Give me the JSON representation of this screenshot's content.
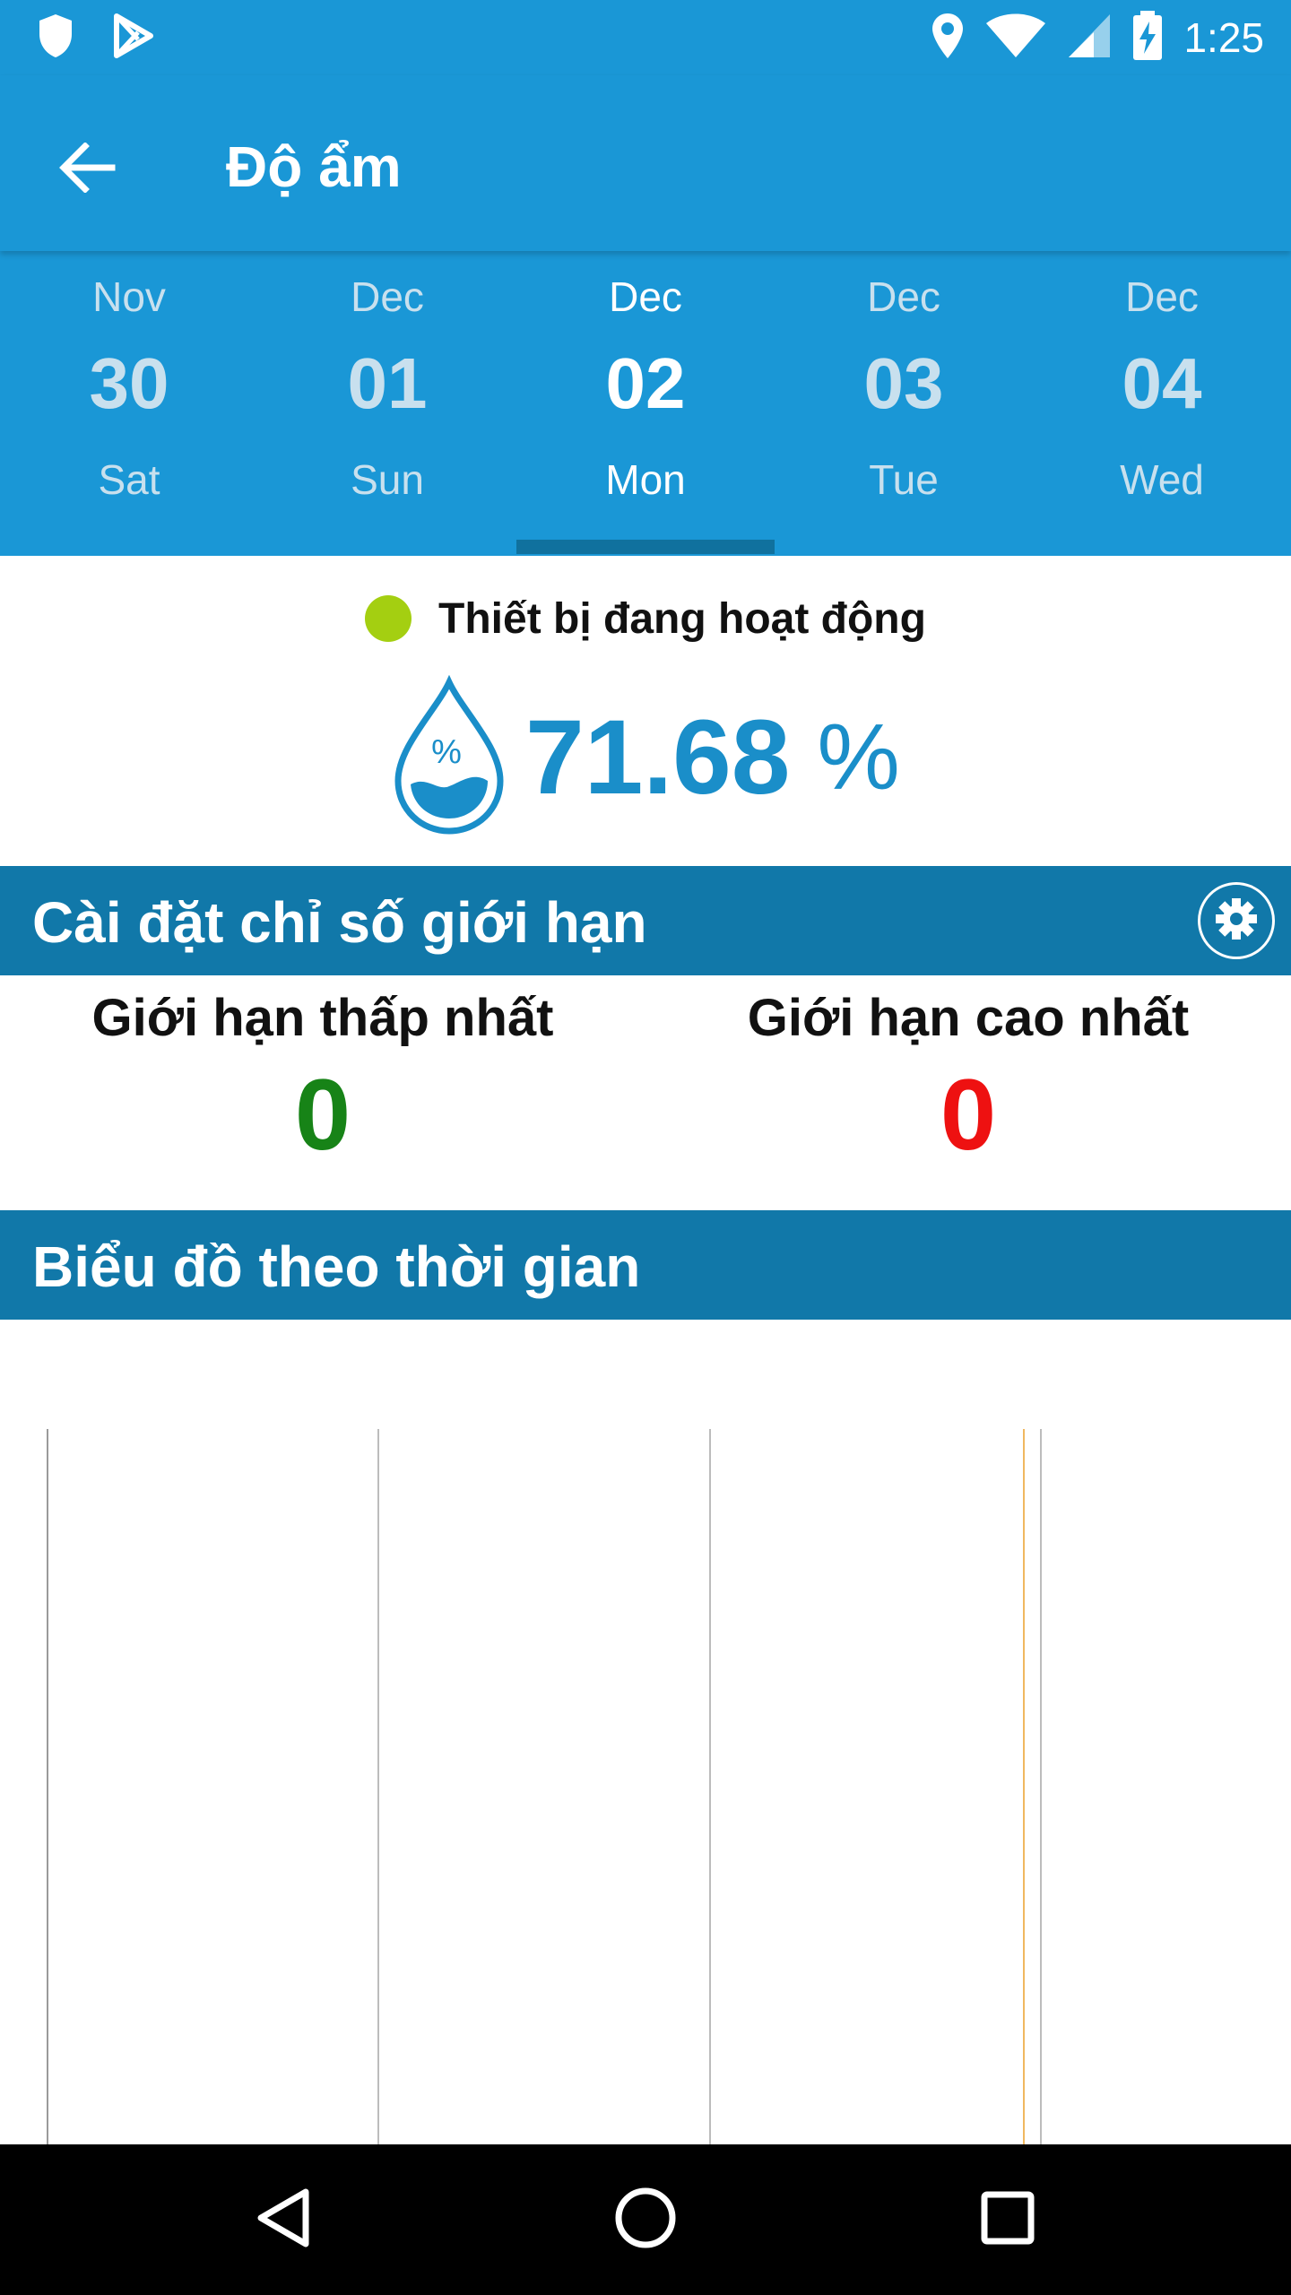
{
  "status_bar": {
    "time": "1:25",
    "left_icons": [
      "shield-icon",
      "play-store-icon"
    ],
    "right_icons": [
      "location-icon",
      "wifi-icon",
      "cell-signal-icon",
      "battery-charging-icon"
    ]
  },
  "app_bar": {
    "title": "Độ ẩm",
    "back_icon": "arrow-left-icon"
  },
  "dates": [
    {
      "month": "Nov",
      "day": "30",
      "weekday": "Sat",
      "selected": false
    },
    {
      "month": "Dec",
      "day": "01",
      "weekday": "Sun",
      "selected": false
    },
    {
      "month": "Dec",
      "day": "02",
      "weekday": "Mon",
      "selected": true
    },
    {
      "month": "Dec",
      "day": "03",
      "weekday": "Tue",
      "selected": false
    },
    {
      "month": "Dec",
      "day": "04",
      "weekday": "Wed",
      "selected": false
    }
  ],
  "device": {
    "status_text": "Thiết bị đang hoạt động",
    "status_color": "#a4cf11"
  },
  "reading": {
    "value": "71.68",
    "unit": "%",
    "icon": "humidity-drop-icon",
    "icon_label": "%"
  },
  "limits_section": {
    "title": "Cài đặt chỉ số giới hạn",
    "settings_icon": "gear-icon",
    "min_label": "Giới hạn thấp nhất",
    "min_value": "0",
    "max_label": "Giới hạn cao nhất",
    "max_value": "0"
  },
  "chart_section": {
    "title": "Biểu đồ theo thời gian"
  },
  "nav_bar": {
    "back_icon": "nav-back-icon",
    "home_icon": "nav-home-icon",
    "recents_icon": "nav-recents-icon"
  },
  "colors": {
    "primary": "#1a97d6",
    "section": "#1178a9",
    "reading": "#1a8ec9",
    "min_value": "#178317",
    "max_value": "#ee1111"
  }
}
